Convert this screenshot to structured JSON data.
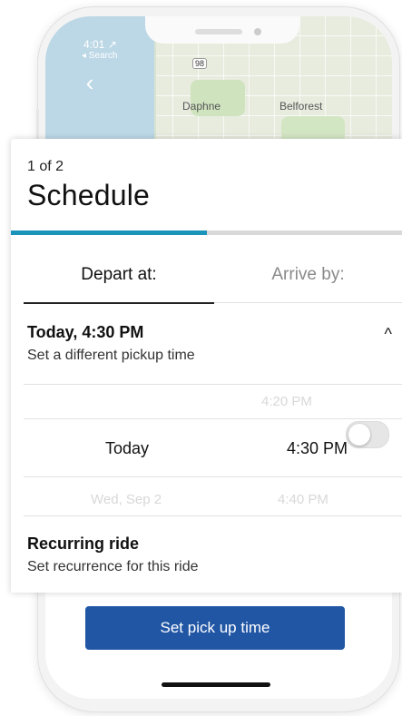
{
  "status_bar": {
    "time": "4:01 ↗",
    "back_app": "◂ Search"
  },
  "map": {
    "labels": {
      "daphne": "Daphne",
      "belforest": "Belforest",
      "route_shield": "98"
    }
  },
  "sheet": {
    "step": "1 of 2",
    "title": "Schedule",
    "progress_fraction": 0.5,
    "tabs": {
      "depart": "Depart at:",
      "arrive": "Arrive by:"
    },
    "selected_time": {
      "title": "Today, 4:30 PM",
      "subtitle": "Set a different pickup time"
    },
    "picker": {
      "prev_time": "4:20 PM",
      "current_day": "Today",
      "current_time": "4:30 PM",
      "next_day": "Wed, Sep 2",
      "next_time": "4:40 PM"
    },
    "recurring": {
      "title": "Recurring ride",
      "subtitle": "Set recurrence for this ride",
      "enabled": false
    }
  },
  "cta": {
    "label": "Set pick up time"
  },
  "colors": {
    "accent": "#1b94b9",
    "primary_button": "#2156a5"
  },
  "icons": {
    "back": "chevron-left-icon",
    "collapse": "chevron-up-icon"
  }
}
